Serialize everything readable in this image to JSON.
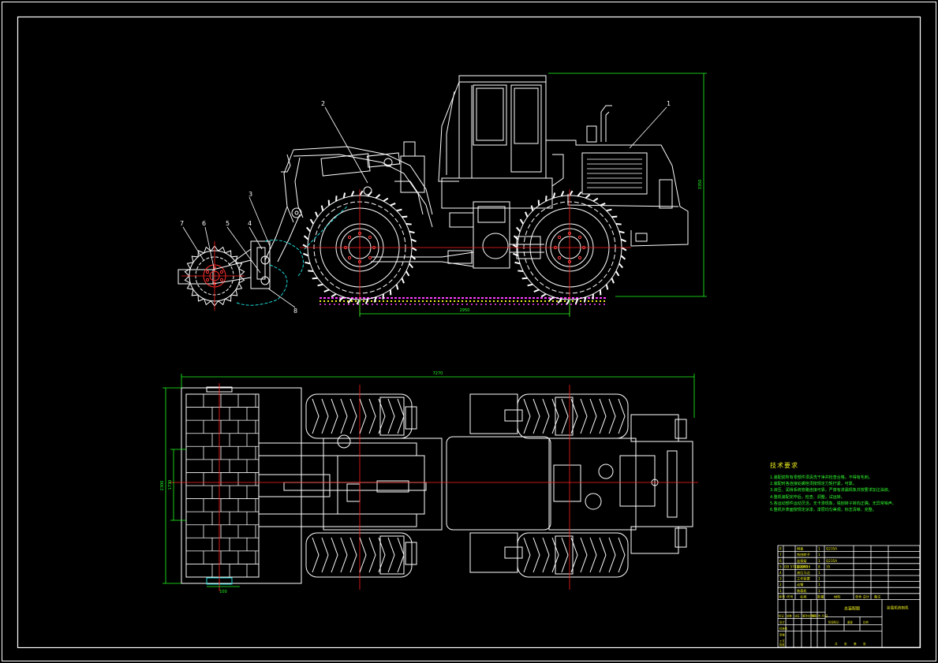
{
  "drawing": {
    "balloons": [
      "1",
      "2",
      "3",
      "4",
      "5",
      "6",
      "7",
      "8"
    ],
    "dimensions": {
      "side_wheelbase": "2950",
      "side_height": "3350",
      "plan_length": "7270",
      "plan_drum_width": "2300",
      "plan_drum_inner": "1730",
      "plan_edge": "100"
    }
  },
  "tech_requirements": {
    "title": "技术要求",
    "lines": [
      "1.装配前所有零部件须清洗干净并检查合格，不得有毛刺。",
      "2.装配时各连接处螺栓须按规定力矩拧紧，可靠。",
      "3.液压、润滑系统管路连接可靠，严禁有渗漏现象并按要求加注油液。",
      "4.整机装配完毕后，检查、调整，试运转。",
      "5.各运动部件运动灵活，无卡滞现象，铣刨转子转向正确，无异常噪声。",
      "6.整机外表面按规定涂漆，漆层均匀美观，标志清晰、完整。"
    ]
  },
  "title_block": {
    "parts": [
      {
        "no": "8",
        "code": "",
        "name": "侧板",
        "qty": "1",
        "material": "Q235A"
      },
      {
        "no": "7",
        "code": "",
        "name": "铣刨转子",
        "qty": "1",
        "material": ""
      },
      {
        "no": "6",
        "code": "",
        "name": "连接架",
        "qty": "1",
        "material": "Q235A"
      },
      {
        "no": "5",
        "code": "GB 5782-2000",
        "name": "螺栓M16",
        "qty": "8",
        "material": "35"
      },
      {
        "no": "4",
        "code": "",
        "name": "液压马达",
        "qty": "1",
        "material": ""
      },
      {
        "no": "3",
        "code": "",
        "name": "工作装置",
        "qty": "1",
        "material": ""
      },
      {
        "no": "2",
        "code": "",
        "name": "动臂",
        "qty": "1",
        "material": ""
      },
      {
        "no": "1",
        "code": "",
        "name": "装载机",
        "qty": "1",
        "material": ""
      }
    ],
    "header": {
      "no": "序号",
      "code": "代号",
      "name": "名称",
      "qty": "数量",
      "material": "材料",
      "mass": "单件 总计",
      "note": "备注"
    },
    "assembly_title": "总装配图",
    "drawing_name": "装载机铣刨机",
    "row_labels": [
      "标记",
      "处数",
      "分区",
      "更改文件号",
      "签名",
      "年.月.日"
    ],
    "bottom_labels": [
      "设计",
      "标准化",
      "审核",
      "工艺",
      "批准"
    ],
    "stage_labels": [
      "阶段标记",
      "重量",
      "比例"
    ],
    "sheet_labels": [
      "共",
      "张",
      "第",
      "张"
    ]
  },
  "colors": {
    "outline": "#ffffff",
    "centerline": "#ff2020",
    "dimension": "#20ff20",
    "hidden": "#20d8d8",
    "ground": "#ff40ff",
    "ground_alt": "#f0f020",
    "text_yellow": "#f0f020",
    "text_green": "#30ff30"
  }
}
